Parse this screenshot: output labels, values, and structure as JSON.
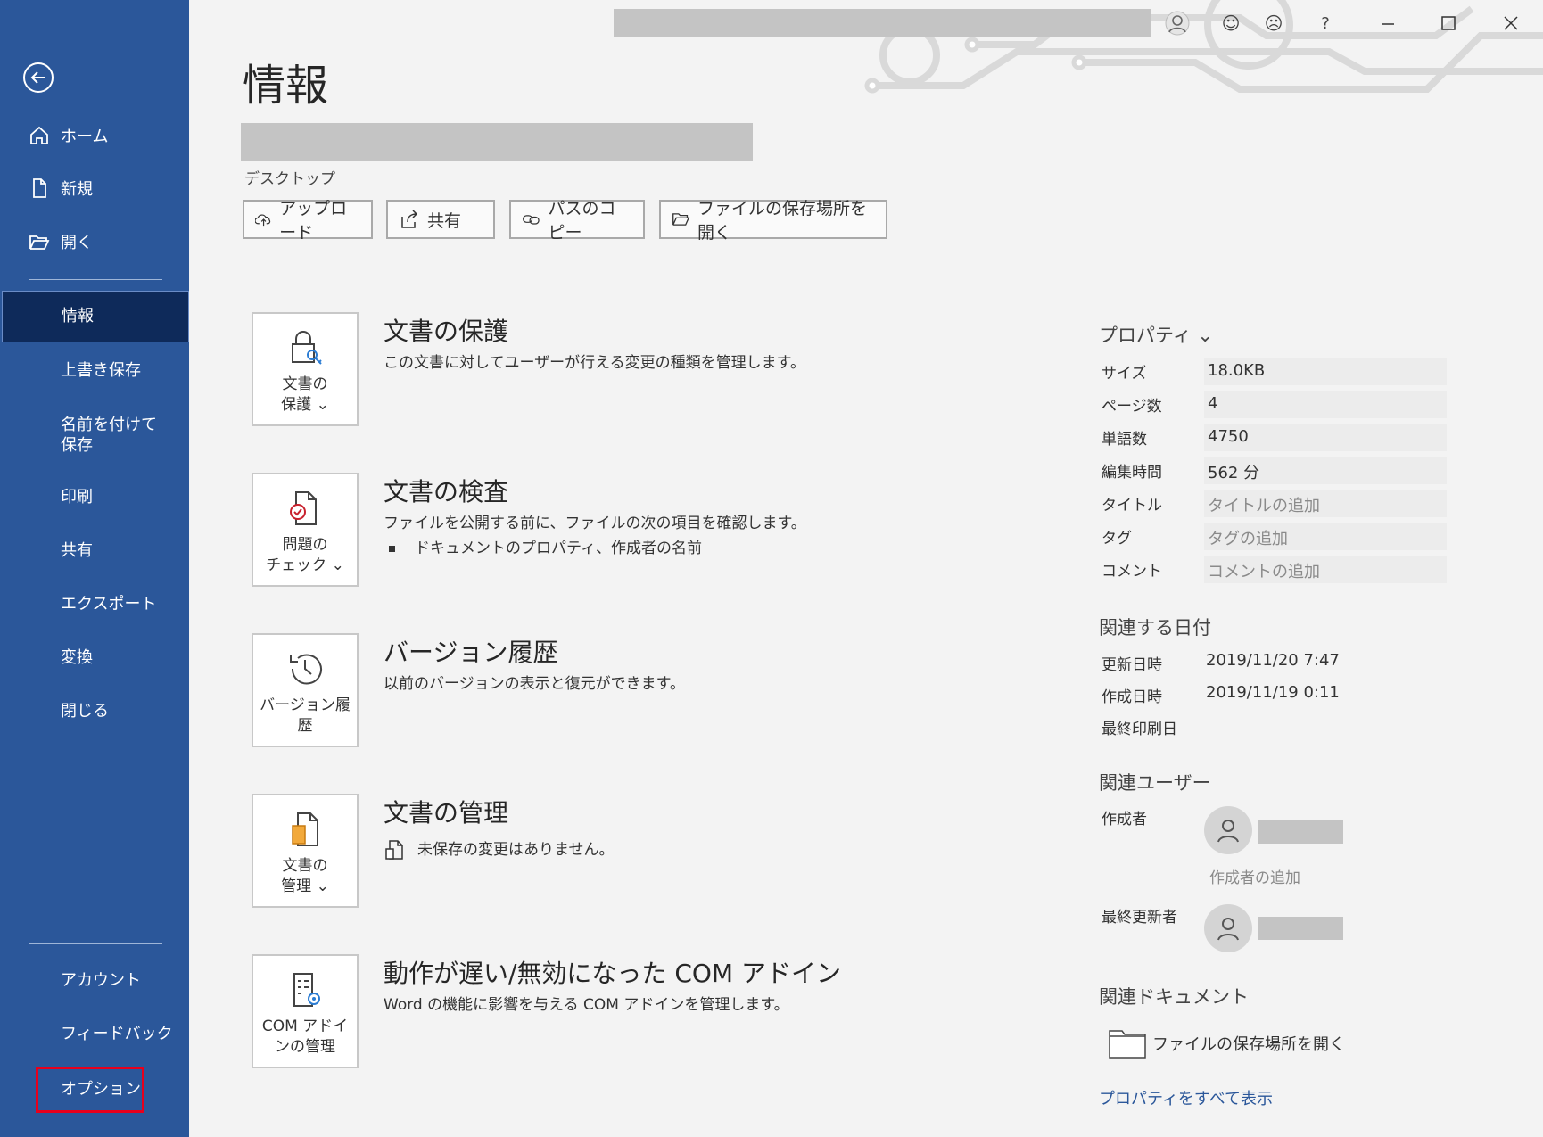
{
  "sidebar": {
    "home": "ホーム",
    "new": "新規",
    "open": "開く",
    "items": [
      "情報",
      "上書き保存",
      "名前を付けて保存",
      "印刷",
      "共有",
      "エクスポート",
      "変換",
      "閉じる"
    ],
    "account": "アカウント",
    "feedback": "フィードバック",
    "options": "オプション"
  },
  "titlebar": {
    "help": "?"
  },
  "page": {
    "title": "情報",
    "path_label": "デスクトップ",
    "actions": [
      "アップロード",
      "共有",
      "パスのコピー",
      "ファイルの保存場所を開く"
    ]
  },
  "sections": [
    {
      "tile": "文書の\n保護 ⌄",
      "title": "文書の保護",
      "desc": "この文書に対してユーザーが行える変更の種類を管理します。"
    },
    {
      "tile": "問題の\nチェック ⌄",
      "title": "文書の検査",
      "desc": "ファイルを公開する前に、ファイルの次の項目を確認します。",
      "bullet": "ドキュメントのプロパティ、作成者の名前"
    },
    {
      "tile": "バージョン履\n歴",
      "title": "バージョン履歴",
      "desc": "以前のバージョンの表示と復元ができます。"
    },
    {
      "tile": "文書の\n管理 ⌄",
      "title": "文書の管理",
      "desc": "未保存の変更はありません。"
    },
    {
      "tile": "COM アドイ\nンの管理",
      "title": "動作が遅い/無効になった COM アドイン",
      "desc": "Word の機能に影響を与える COM アドインを管理します。"
    }
  ],
  "properties": {
    "heading": "プロパティ ⌄",
    "rows": [
      {
        "key": "サイズ",
        "value": "18.0KB"
      },
      {
        "key": "ページ数",
        "value": "4"
      },
      {
        "key": "単語数",
        "value": "4750"
      },
      {
        "key": "編集時間",
        "value": "562 分"
      },
      {
        "key": "タイトル",
        "value": "タイトルの追加"
      },
      {
        "key": "タグ",
        "value": "タグの追加"
      },
      {
        "key": "コメント",
        "value": "コメントの追加"
      }
    ],
    "dates_heading": "関連する日付",
    "dates": [
      {
        "key": "更新日時",
        "value": "2019/11/20 7:47"
      },
      {
        "key": "作成日時",
        "value": "2019/11/19 0:11"
      },
      {
        "key": "最終印刷日",
        "value": ""
      }
    ],
    "people_heading": "関連ユーザー",
    "author_label": "作成者",
    "add_author": "作成者の追加",
    "last_modified_by": "最終更新者",
    "docs_heading": "関連ドキュメント",
    "open_location": "ファイルの保存場所を開く",
    "show_all": "プロパティをすべて表示"
  }
}
